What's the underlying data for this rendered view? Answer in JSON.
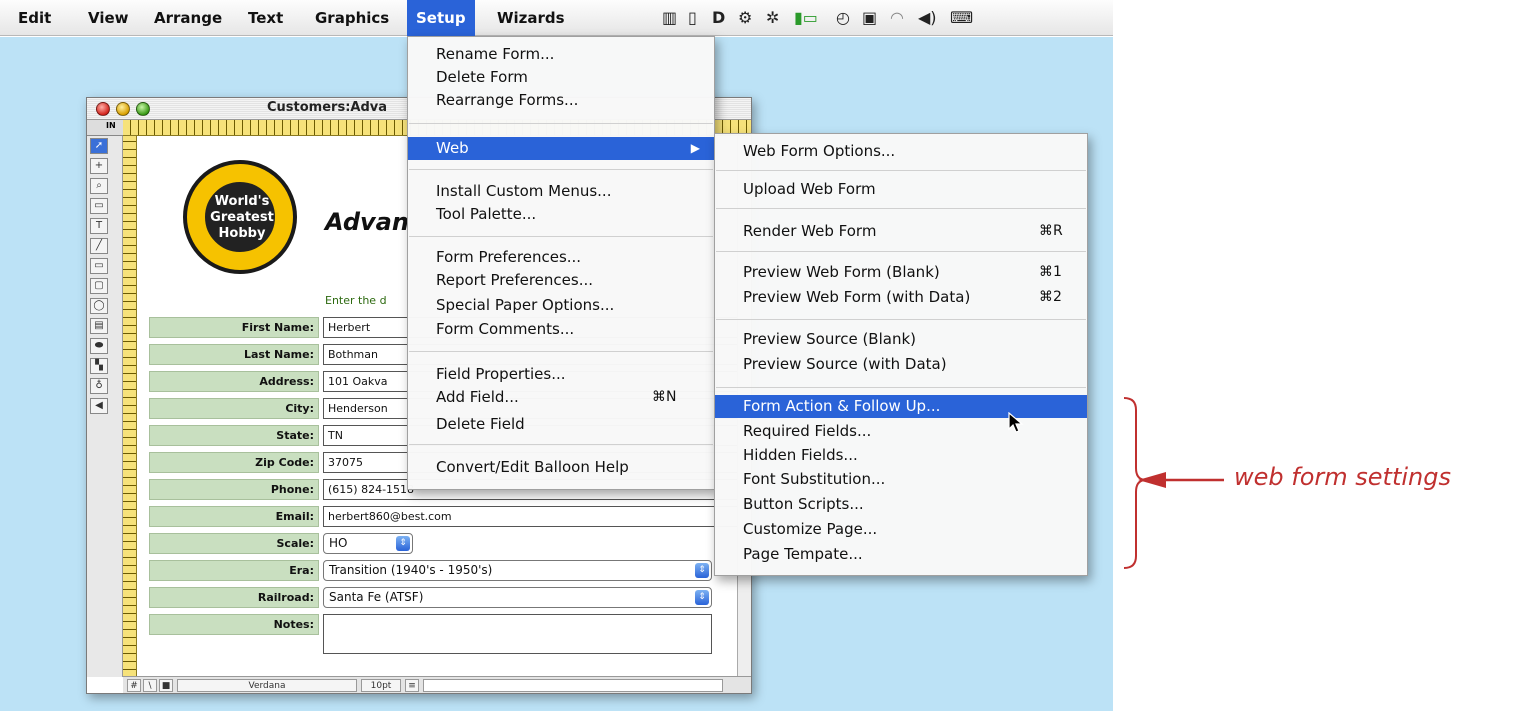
{
  "menubar": {
    "items": [
      "Edit",
      "View",
      "Arrange",
      "Text",
      "Graphics",
      "Setup",
      "Wizards"
    ],
    "active": "Setup",
    "status_icons": [
      "document-icon",
      "page-icon",
      "d-icon",
      "gears-icon",
      "gear-script-icon",
      "battery-icon",
      "clock-icon",
      "display-icon",
      "wifi-icon",
      "volume-icon",
      "keyboard-icon"
    ]
  },
  "window": {
    "title": "Customers:Adva",
    "ruler_unit": "IN",
    "logo_text": "World's\nGreatest\nHobby",
    "heading": "Advan",
    "instruction": "Enter the d",
    "fields": [
      {
        "label": "First Name:",
        "value": "Herbert"
      },
      {
        "label": "Last Name:",
        "value": "Bothman"
      },
      {
        "label": "Address:",
        "value": "101 Oakva"
      },
      {
        "label": "City:",
        "value": "Henderson"
      },
      {
        "label": "State:",
        "value": "TN"
      },
      {
        "label": "Zip Code:",
        "value": "37075"
      },
      {
        "label": "Phone:",
        "value": "(615) 824-1518"
      },
      {
        "label": "Email:",
        "value": "herbert860@best.com"
      },
      {
        "label": "Scale:",
        "value": "HO"
      },
      {
        "label": "Era:",
        "value": "Transition (1940's - 1950's)"
      },
      {
        "label": "Railroad:",
        "value": "Santa Fe (ATSF)"
      },
      {
        "label": "Notes:",
        "value": ""
      }
    ],
    "font_name": "Verdana",
    "font_size": "10pt"
  },
  "setup_menu": {
    "items": [
      {
        "label": "Rename Form..."
      },
      {
        "label": "Delete Form"
      },
      {
        "label": "Rearrange Forms..."
      },
      {
        "label": "Web",
        "submenu": true
      },
      {
        "label": "Install Custom Menus..."
      },
      {
        "label": "Tool Palette..."
      },
      {
        "label": "Form Preferences..."
      },
      {
        "label": "Report Preferences..."
      },
      {
        "label": "Special Paper Options..."
      },
      {
        "label": "Form Comments..."
      },
      {
        "label": "Field Properties..."
      },
      {
        "label": "Add Field...",
        "shortcut": "⌘N"
      },
      {
        "label": "Delete Field"
      },
      {
        "label": "Convert/Edit Balloon Help"
      }
    ]
  },
  "web_submenu": {
    "items": [
      {
        "label": "Web Form Options..."
      },
      {
        "label": "Upload Web Form"
      },
      {
        "label": "Render Web Form",
        "shortcut": "⌘R"
      },
      {
        "label": "Preview Web Form (Blank)",
        "shortcut": "⌘1"
      },
      {
        "label": "Preview Web Form (with Data)",
        "shortcut": "⌘2"
      },
      {
        "label": "Preview Source (Blank)"
      },
      {
        "label": "Preview Source (with Data)"
      },
      {
        "label": "Form Action & Follow Up..."
      },
      {
        "label": "Required Fields..."
      },
      {
        "label": "Hidden Fields..."
      },
      {
        "label": "Font Substitution..."
      },
      {
        "label": "Button Scripts..."
      },
      {
        "label": "Customize Page..."
      },
      {
        "label": "Page Tempate..."
      }
    ]
  },
  "annotation": {
    "text": "web form settings",
    "color": "#c0302f"
  }
}
